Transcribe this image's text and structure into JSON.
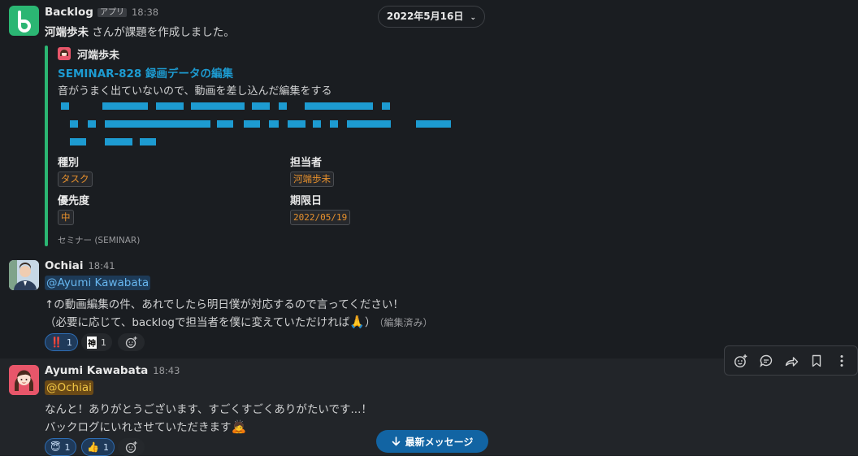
{
  "date_divider": {
    "label": "2022年5月16日"
  },
  "messages": [
    {
      "author": "Backlog",
      "app_badge": "アプリ",
      "time": "18:38",
      "text_author": "河端歩未",
      "text_rest": " さんが課題を作成しました。",
      "attachment": {
        "user": "河端歩未",
        "issue_title": "SEMINAR-828 録画データの編集",
        "description": "音がうまく出ていないので、動画を差し込んだ編集をする",
        "fields": [
          {
            "label": "種別",
            "value": "タスク"
          },
          {
            "label": "担当者",
            "value": "河端歩未"
          },
          {
            "label": "優先度",
            "value": "中"
          },
          {
            "label": "期限日",
            "value": "2022/05/19"
          }
        ],
        "footer": "セミナー (SEMINAR)"
      }
    },
    {
      "author": "Ochiai",
      "time": "18:41",
      "mention": "@Ayumi Kawabata",
      "line1": "↑の動画編集の件、あれでしたら明日僕が対応するので言ってください！",
      "line2": "（必要に応じて、backlogで担当者を僕に変えていただければ",
      "line2_end": "）",
      "edited": "（編集済み）",
      "reactions": [
        {
          "emoji": "‼️",
          "count": "1"
        },
        {
          "emoji": "神",
          "count": "1"
        }
      ]
    },
    {
      "author": "Ayumi Kawabata",
      "time": "18:43",
      "mention": "@Ochiai",
      "line1": "なんと！ありがとうございます、すごくすごくありがたいです...！",
      "line2": "バックログにいれさせていただきます",
      "reactions": [
        {
          "emoji": "😇",
          "count": "1"
        },
        {
          "emoji": "👍",
          "count": "1"
        }
      ]
    }
  ],
  "new_messages_button": {
    "label": "最新メッセージ",
    "icon": "arrow-down-icon"
  },
  "colors": {
    "accent_green": "#2bb673",
    "link_blue": "#1d9bd1",
    "button_blue": "#1264a3"
  }
}
